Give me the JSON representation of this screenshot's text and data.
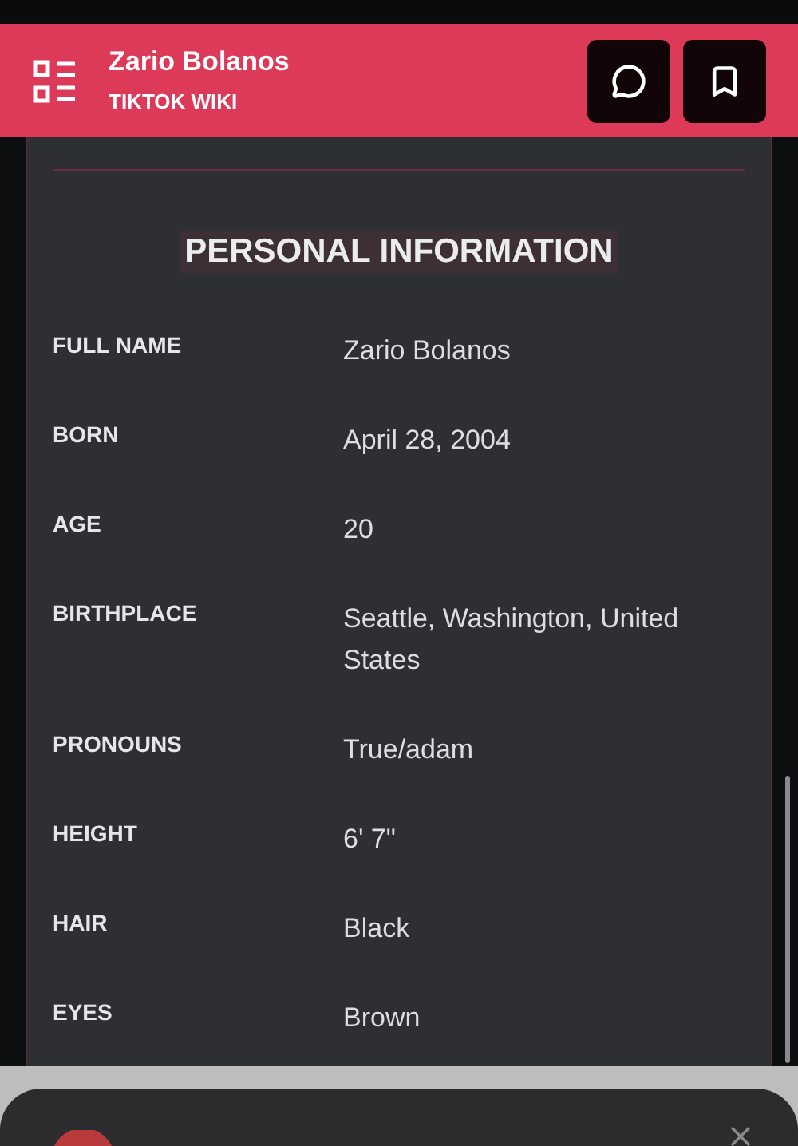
{
  "header": {
    "title": "Zario Bolanos",
    "subtitle": "TIKTOK WIKI"
  },
  "section": {
    "title": "PERSONAL INFORMATION",
    "rows": [
      {
        "label": "FULL NAME",
        "value": "Zario Bolanos"
      },
      {
        "label": "BORN",
        "value": "April 28, 2004"
      },
      {
        "label": "AGE",
        "value": "20"
      },
      {
        "label": "BIRTHPLACE",
        "value": "Seattle, Washington, United States"
      },
      {
        "label": "PRONOUNS",
        "value": "True/adam"
      },
      {
        "label": "HEIGHT",
        "value": "6' 7\""
      },
      {
        "label": "HAIR",
        "value": "Black"
      },
      {
        "label": "EYES",
        "value": "Brown"
      }
    ]
  }
}
